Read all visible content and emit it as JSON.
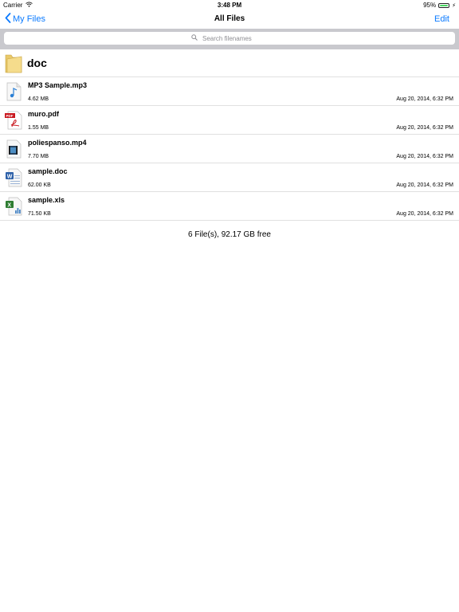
{
  "status_bar": {
    "carrier": "Carrier",
    "time": "3:48 PM",
    "battery": "95%",
    "battery_level": 0.95
  },
  "nav": {
    "back_label": "My Files",
    "title": "All Files",
    "edit_label": "Edit"
  },
  "search": {
    "placeholder": "Search filenames"
  },
  "folder": {
    "name": "doc",
    "icon": "folder-icon"
  },
  "files": [
    {
      "name": "MP3 Sample.mp3",
      "size": "4.62 MB",
      "date": "Aug 20, 2014, 6:32 PM",
      "icon": "audio-file-icon"
    },
    {
      "name": "muro.pdf",
      "size": "1.55 MB",
      "date": "Aug 20, 2014, 6:32 PM",
      "icon": "pdf-file-icon"
    },
    {
      "name": "poliespanso.mp4",
      "size": "7.70 MB",
      "date": "Aug 20, 2014, 6:32 PM",
      "icon": "video-file-icon"
    },
    {
      "name": "sample.doc",
      "size": "62.00 KB",
      "date": "Aug 20, 2014, 6:32 PM",
      "icon": "word-file-icon"
    },
    {
      "name": "sample.xls",
      "size": "71.50 KB",
      "date": "Aug 20, 2014, 6:32 PM",
      "icon": "excel-file-icon"
    }
  ],
  "footer": {
    "summary": "6 File(s), 92.17 GB free"
  },
  "colors": {
    "accent": "#0a7aff",
    "battery": "#4cd964",
    "search_bg": "#c9c9ce"
  }
}
